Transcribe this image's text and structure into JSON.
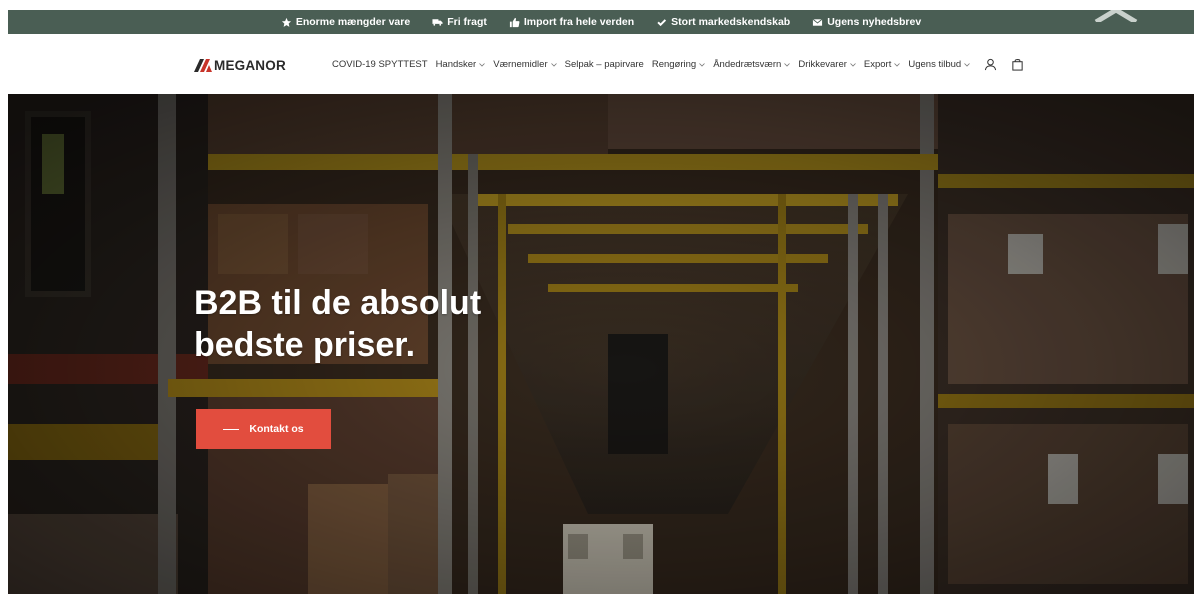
{
  "promo": {
    "items": [
      {
        "icon": "star-icon",
        "label": "Enorme mængder vare"
      },
      {
        "icon": "truck-icon",
        "label": "Fri fragt"
      },
      {
        "icon": "thumbs-up-icon",
        "label": "Import fra hele verden"
      },
      {
        "icon": "checkmark-icon",
        "label": "Stort markedskendskab"
      },
      {
        "icon": "envelope-icon",
        "label": "Ugens nyhedsbrev"
      }
    ]
  },
  "brand": {
    "name": "MEGANOR"
  },
  "nav": {
    "items": [
      {
        "label": "COVID-19 SPYTTEST",
        "dropdown": false
      },
      {
        "label": "Handsker",
        "dropdown": true
      },
      {
        "label": "Værnemidler",
        "dropdown": true
      },
      {
        "label": "Selpak – papirvare",
        "dropdown": false
      },
      {
        "label": "Rengøring",
        "dropdown": true
      },
      {
        "label": "Åndedrætsværn",
        "dropdown": true
      },
      {
        "label": "Drikkevarer",
        "dropdown": true
      },
      {
        "label": "Export",
        "dropdown": true
      },
      {
        "label": "Ugens tilbud",
        "dropdown": true
      }
    ],
    "icons": [
      "user-icon",
      "shopping-bag-icon"
    ]
  },
  "hero": {
    "title_line1": "B2B til de absolut",
    "title_line2": "bedste priser.",
    "cta_label": "Kontakt os"
  },
  "colors": {
    "promo_bar": "#4a5e54",
    "cta": "#e24d3e",
    "logo_red": "#c8342a",
    "logo_dark": "#2a2a2a"
  }
}
